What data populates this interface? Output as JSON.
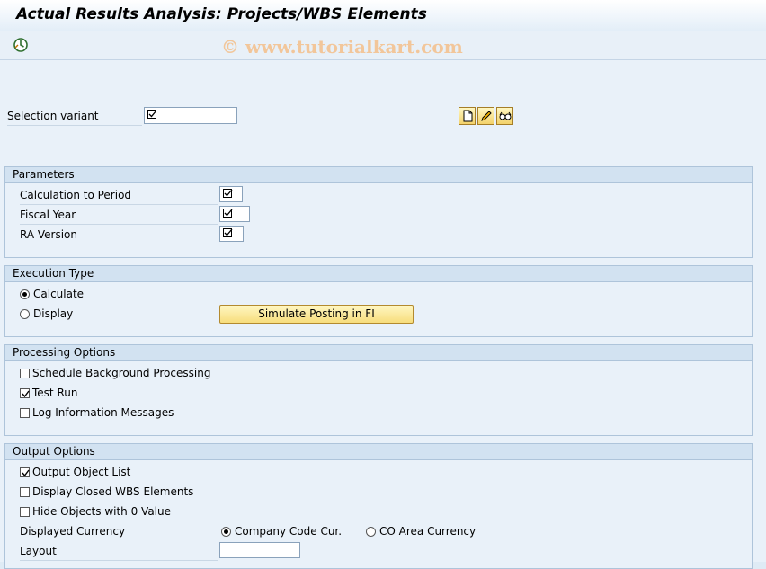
{
  "window": {
    "title": "Actual Results Analysis: Projects/WBS Elements"
  },
  "toolbar": {
    "execute_icon": "execute-clock-icon"
  },
  "watermark": "© www.tutorialkart.com",
  "selection": {
    "label": "Selection variant",
    "value": "",
    "buttons": [
      {
        "icon": "create-document-icon"
      },
      {
        "icon": "edit-pencil-icon"
      },
      {
        "icon": "display-glasses-icon"
      }
    ]
  },
  "parameters": {
    "title": "Parameters",
    "fields": [
      {
        "label": "Calculation to Period",
        "value": ""
      },
      {
        "label": "Fiscal Year",
        "value": ""
      },
      {
        "label": "RA Version",
        "value": ""
      }
    ]
  },
  "execution": {
    "title": "Execution Type",
    "calculate_label": "Calculate",
    "display_label": "Display",
    "selected": "calculate",
    "simulate_button": "Simulate Posting in FI"
  },
  "processing": {
    "title": "Processing Options",
    "options": [
      {
        "label": "Schedule Background Processing",
        "checked": false
      },
      {
        "label": "Test Run",
        "checked": true
      },
      {
        "label": "Log Information Messages",
        "checked": false
      }
    ]
  },
  "output": {
    "title": "Output Options",
    "options": [
      {
        "label": "Output Object List",
        "checked": true
      },
      {
        "label": "Display Closed WBS Elements",
        "checked": false
      },
      {
        "label": "Hide Objects with 0 Value",
        "checked": false
      }
    ],
    "currency_label": "Displayed Currency",
    "company_code_label": "Company Code Cur.",
    "co_area_label": "CO Area Currency",
    "currency_selected": "company_code",
    "layout_label": "Layout",
    "layout_value": ""
  },
  "colors": {
    "button_yellow": "#f7dd7c",
    "panel": "#e9f1f9",
    "group_header": "#d2e2f1"
  }
}
